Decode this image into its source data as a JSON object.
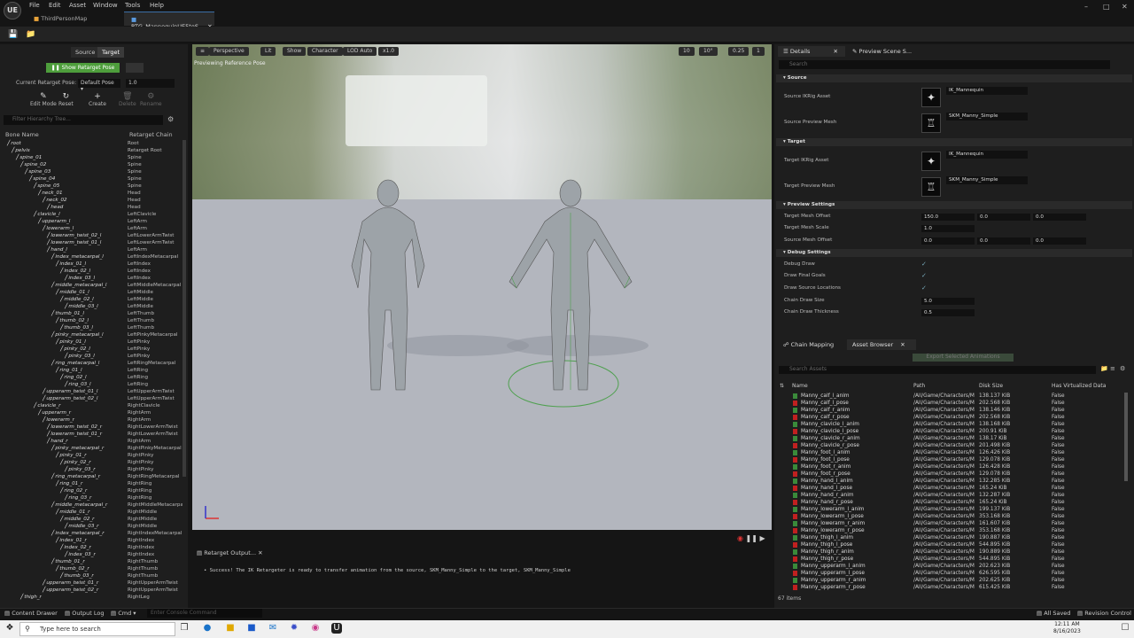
{
  "menubar": {
    "items": [
      "File",
      "Edit",
      "Asset",
      "Window",
      "Tools",
      "Help"
    ]
  },
  "tabs": [
    {
      "label": "ThirdPersonMap"
    },
    {
      "label": "RTG_MannequinUE5toS..."
    }
  ],
  "left": {
    "tab_source": "Source",
    "tab_target": "Target",
    "show_retarget": "Show Retarget Pose",
    "pose_label": "Current Retarget Pose:",
    "pose_value": "Default Pose",
    "pose_num": "1.0",
    "tools": [
      "Edit Mode",
      "Reset",
      "Create",
      "Delete",
      "Rename"
    ],
    "search_placeholder": "Filter Hierarchy Tree...",
    "col_bone": "Bone Name",
    "col_chain": "Retarget Chain",
    "bones": [
      [
        "root",
        "Root",
        0
      ],
      [
        "pelvis",
        "Retarget Root",
        1
      ],
      [
        "spine_01",
        "Spine",
        2
      ],
      [
        "spine_02",
        "Spine",
        3
      ],
      [
        "spine_03",
        "Spine",
        4
      ],
      [
        "spine_04",
        "Spine",
        5
      ],
      [
        "spine_05",
        "Spine",
        6
      ],
      [
        "neck_01",
        "Head",
        7
      ],
      [
        "neck_02",
        "Head",
        8
      ],
      [
        "head",
        "Head",
        9
      ],
      [
        "clavicle_l",
        "LeftClavicle",
        6
      ],
      [
        "upperarm_l",
        "LeftArm",
        7
      ],
      [
        "lowerarm_l",
        "LeftArm",
        8
      ],
      [
        "lowerarm_twist_02_l",
        "LeftLowerArmTwist",
        9
      ],
      [
        "lowerarm_twist_01_l",
        "LeftLowerArmTwist",
        9
      ],
      [
        "hand_l",
        "LeftArm",
        9
      ],
      [
        "index_metacarpal_l",
        "LeftIndexMetacarpal",
        10
      ],
      [
        "index_01_l",
        "LeftIndex",
        11
      ],
      [
        "index_02_l",
        "LeftIndex",
        12
      ],
      [
        "index_03_l",
        "LeftIndex",
        13
      ],
      [
        "middle_metacarpal_l",
        "LeftMiddleMetacarpal",
        10
      ],
      [
        "middle_01_l",
        "LeftMiddle",
        11
      ],
      [
        "middle_02_l",
        "LeftMiddle",
        12
      ],
      [
        "middle_03_l",
        "LeftMiddle",
        13
      ],
      [
        "thumb_01_l",
        "LeftThumb",
        10
      ],
      [
        "thumb_02_l",
        "LeftThumb",
        11
      ],
      [
        "thumb_03_l",
        "LeftThumb",
        12
      ],
      [
        "pinky_metacarpal_l",
        "LeftPinkyMetacarpal",
        10
      ],
      [
        "pinky_01_l",
        "LeftPinky",
        11
      ],
      [
        "pinky_02_l",
        "LeftPinky",
        12
      ],
      [
        "pinky_03_l",
        "LeftPinky",
        13
      ],
      [
        "ring_metacarpal_l",
        "LeftRingMetacarpal",
        10
      ],
      [
        "ring_01_l",
        "LeftRing",
        11
      ],
      [
        "ring_02_l",
        "LeftRing",
        12
      ],
      [
        "ring_03_l",
        "LeftRing",
        13
      ],
      [
        "upperarm_twist_01_l",
        "LeftUpperArmTwist",
        8
      ],
      [
        "upperarm_twist_02_l",
        "LeftUpperArmTwist",
        8
      ],
      [
        "clavicle_r",
        "RightClavicle",
        6
      ],
      [
        "upperarm_r",
        "RightArm",
        7
      ],
      [
        "lowerarm_r",
        "RightArm",
        8
      ],
      [
        "lowerarm_twist_02_r",
        "RightLowerArmTwist",
        9
      ],
      [
        "lowerarm_twist_01_r",
        "RightLowerArmTwist",
        9
      ],
      [
        "hand_r",
        "RightArm",
        9
      ],
      [
        "pinky_metacarpal_r",
        "RightPinkyMetacarpal",
        10
      ],
      [
        "pinky_01_r",
        "RightPinky",
        11
      ],
      [
        "pinky_02_r",
        "RightPinky",
        12
      ],
      [
        "pinky_03_r",
        "RightPinky",
        13
      ],
      [
        "ring_metacarpal_r",
        "RightRingMetacarpal",
        10
      ],
      [
        "ring_01_r",
        "RightRing",
        11
      ],
      [
        "ring_02_r",
        "RightRing",
        12
      ],
      [
        "ring_03_r",
        "RightRing",
        13
      ],
      [
        "middle_metacarpal_r",
        "RightMiddleMetacarpal",
        10
      ],
      [
        "middle_01_r",
        "RightMiddle",
        11
      ],
      [
        "middle_02_r",
        "RightMiddle",
        12
      ],
      [
        "middle_03_r",
        "RightMiddle",
        13
      ],
      [
        "index_metacarpal_r",
        "RightIndexMetacarpal",
        10
      ],
      [
        "index_01_r",
        "RightIndex",
        11
      ],
      [
        "index_02_r",
        "RightIndex",
        12
      ],
      [
        "index_03_r",
        "RightIndex",
        13
      ],
      [
        "thumb_01_r",
        "RightThumb",
        10
      ],
      [
        "thumb_02_r",
        "RightThumb",
        11
      ],
      [
        "thumb_03_r",
        "RightThumb",
        12
      ],
      [
        "upperarm_twist_01_r",
        "RightUpperArmTwist",
        8
      ],
      [
        "upperarm_twist_02_r",
        "RightUpperArmTwist",
        8
      ],
      [
        "thigh_r",
        "RightLeg",
        3
      ]
    ]
  },
  "viewport": {
    "buttons": [
      "Perspective",
      "Lit",
      "Show",
      "Character",
      "LOD Auto",
      "x1.0"
    ],
    "label": "Previewing Reference Pose",
    "right_values": [
      "10",
      "10°",
      "0.25",
      "1"
    ]
  },
  "output": {
    "tab": "Retarget Output...",
    "message": "• Success! The IK Retargeter is ready to transfer animation from the source, SKM_Manny_Simple to the target, SKM_Manny_Simple"
  },
  "details": {
    "tab": "Details",
    "tab2": "Preview Scene S...",
    "search_placeholder": "Search",
    "source_hdr": "Source",
    "target_hdr": "Target",
    "source_ik_label": "Source IKRig Asset",
    "source_ik_value": "IK_Mannequin",
    "source_mesh_label": "Source Preview Mesh",
    "source_mesh_value": "SKM_Manny_Simple",
    "target_ik_label": "Target IKRig Asset",
    "target_ik_value": "IK_Mannequin",
    "target_mesh_label": "Target Preview Mesh",
    "target_mesh_value": "SKM_Manny_Simple",
    "preview_hdr": "Preview Settings",
    "target_offset_label": "Target Mesh Offset",
    "target_offset": [
      "150.0",
      "0.0",
      "0.0"
    ],
    "target_scale_label": "Target Mesh Scale",
    "target_scale": "1.0",
    "source_offset_label": "Source Mesh Offset",
    "source_offset": [
      "0.0",
      "0.0",
      "0.0"
    ],
    "debug_hdr": "Debug Settings",
    "debug_draw": "Debug Draw",
    "draw_goals": "Draw Final Goals",
    "draw_source": "Draw Source Locations",
    "chain_size_label": "Chain Draw Size",
    "chain_size": "5.0",
    "chain_thick_label": "Chain Draw Thickness",
    "chain_thick": "0.5"
  },
  "asset_browser": {
    "tab1": "Chain Mapping",
    "tab2": "Asset Browser",
    "export": "Export Selected Animations",
    "search_placeholder": "Search Assets",
    "cols": [
      "Name",
      "Path",
      "Disk Size",
      "Has Virtualized Data"
    ],
    "rows": [
      [
        "Manny_calf_l_anim",
        "/All/Game/Characters/M",
        "138.137 KiB",
        "False",
        "#3a8a3a"
      ],
      [
        "Manny_calf_l_pose",
        "/All/Game/Characters/M",
        "202.568 KiB",
        "False",
        "#c02020"
      ],
      [
        "Manny_calf_r_anim",
        "/All/Game/Characters/M",
        "138.146 KiB",
        "False",
        "#3a8a3a"
      ],
      [
        "Manny_calf_r_pose",
        "/All/Game/Characters/M",
        "202.568 KiB",
        "False",
        "#c02020"
      ],
      [
        "Manny_clavicle_l_anim",
        "/All/Game/Characters/M",
        "138.168 KiB",
        "False",
        "#3a8a3a"
      ],
      [
        "Manny_clavicle_l_pose",
        "/All/Game/Characters/M",
        "200.91 KiB",
        "False",
        "#c02020"
      ],
      [
        "Manny_clavicle_r_anim",
        "/All/Game/Characters/M",
        "138.17 KiB",
        "False",
        "#3a8a3a"
      ],
      [
        "Manny_clavicle_r_pose",
        "/All/Game/Characters/M",
        "201.498 KiB",
        "False",
        "#c02020"
      ],
      [
        "Manny_foot_l_anim",
        "/All/Game/Characters/M",
        "126.426 KiB",
        "False",
        "#3a8a3a"
      ],
      [
        "Manny_foot_l_pose",
        "/All/Game/Characters/M",
        "129.078 KiB",
        "False",
        "#c02020"
      ],
      [
        "Manny_foot_r_anim",
        "/All/Game/Characters/M",
        "126.428 KiB",
        "False",
        "#3a8a3a"
      ],
      [
        "Manny_foot_r_pose",
        "/All/Game/Characters/M",
        "129.078 KiB",
        "False",
        "#c02020"
      ],
      [
        "Manny_hand_l_anim",
        "/All/Game/Characters/M",
        "132.285 KiB",
        "False",
        "#3a8a3a"
      ],
      [
        "Manny_hand_l_pose",
        "/All/Game/Characters/M",
        "165.24 KiB",
        "False",
        "#c02020"
      ],
      [
        "Manny_hand_r_anim",
        "/All/Game/Characters/M",
        "132.287 KiB",
        "False",
        "#3a8a3a"
      ],
      [
        "Manny_hand_r_pose",
        "/All/Game/Characters/M",
        "165.24 KiB",
        "False",
        "#c02020"
      ],
      [
        "Manny_lowerarm_l_anim",
        "/All/Game/Characters/M",
        "199.137 KiB",
        "False",
        "#3a8a3a"
      ],
      [
        "Manny_lowerarm_l_pose",
        "/All/Game/Characters/M",
        "353.168 KiB",
        "False",
        "#c02020"
      ],
      [
        "Manny_lowerarm_r_anim",
        "/All/Game/Characters/M",
        "161.607 KiB",
        "False",
        "#3a8a3a"
      ],
      [
        "Manny_lowerarm_r_pose",
        "/All/Game/Characters/M",
        "353.168 KiB",
        "False",
        "#c02020"
      ],
      [
        "Manny_thigh_l_anim",
        "/All/Game/Characters/M",
        "190.887 KiB",
        "False",
        "#3a8a3a"
      ],
      [
        "Manny_thigh_l_pose",
        "/All/Game/Characters/M",
        "544.895 KiB",
        "False",
        "#c02020"
      ],
      [
        "Manny_thigh_r_anim",
        "/All/Game/Characters/M",
        "190.889 KiB",
        "False",
        "#3a8a3a"
      ],
      [
        "Manny_thigh_r_pose",
        "/All/Game/Characters/M",
        "544.895 KiB",
        "False",
        "#c02020"
      ],
      [
        "Manny_upperarm_l_anim",
        "/All/Game/Characters/M",
        "202.623 KiB",
        "False",
        "#3a8a3a"
      ],
      [
        "Manny_upperarm_l_pose",
        "/All/Game/Characters/M",
        "626.595 KiB",
        "False",
        "#c02020"
      ],
      [
        "Manny_upperarm_r_anim",
        "/All/Game/Characters/M",
        "202.625 KiB",
        "False",
        "#3a8a3a"
      ],
      [
        "Manny_upperarm_r_pose",
        "/All/Game/Characters/M",
        "615.425 KiB",
        "False",
        "#c02020"
      ]
    ],
    "count": "67 items"
  },
  "status": {
    "content_drawer": "Content Drawer",
    "output_log": "Output Log",
    "cmd": "Cmd",
    "console_placeholder": "Enter Console Command",
    "saved": "All Saved",
    "revision": "Revision Control"
  },
  "taskbar": {
    "search": "Type here to search",
    "time": "12:11 AM",
    "date": "8/16/2023"
  }
}
